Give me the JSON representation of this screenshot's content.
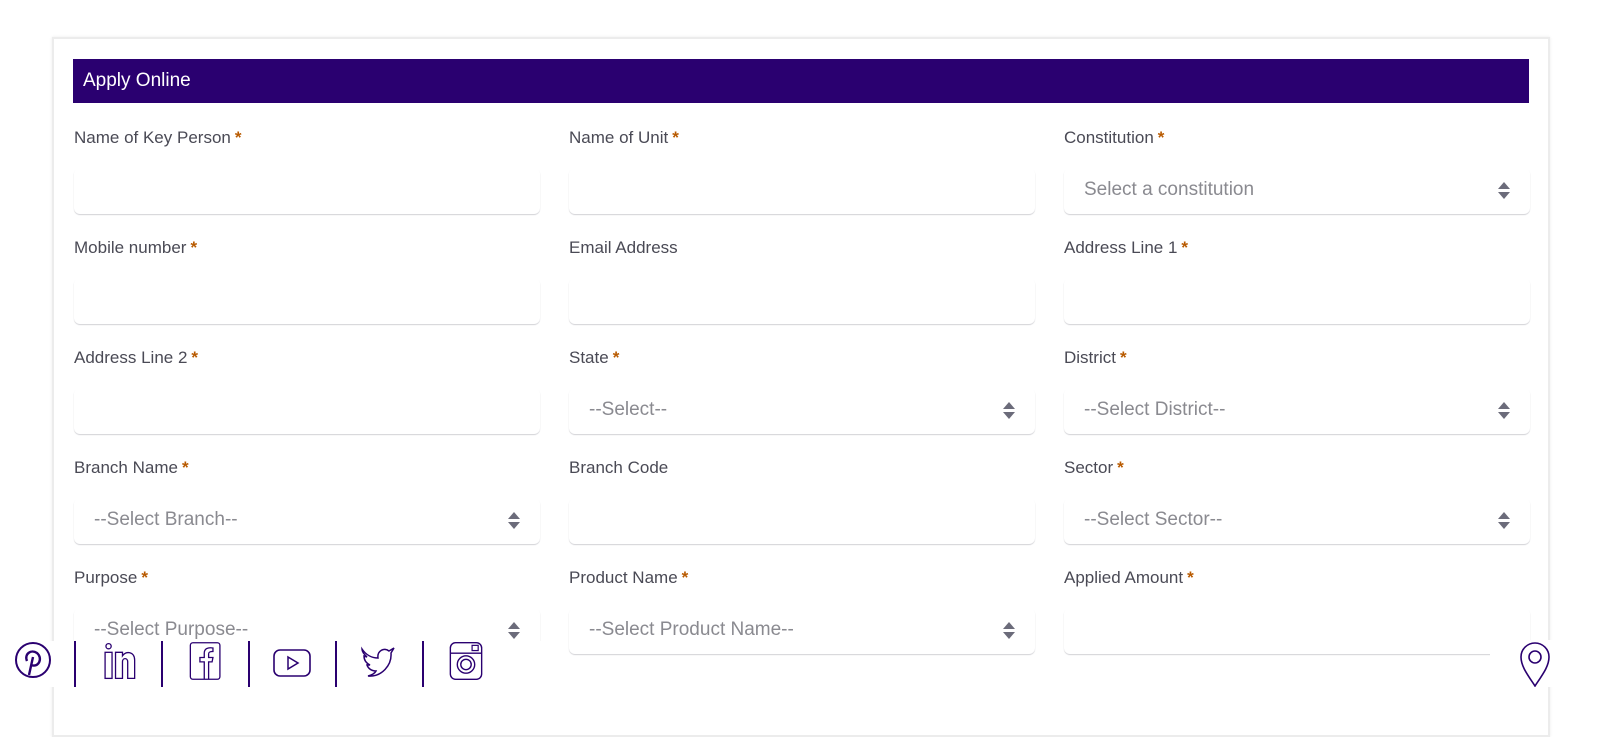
{
  "header": {
    "title": "Apply Online"
  },
  "colors": {
    "header_bg": "#2a0070",
    "required": "#b85a00",
    "icon": "#2a0070"
  },
  "fields": [
    {
      "label": "Name of Key Person",
      "required": true,
      "type": "input",
      "value": ""
    },
    {
      "label": "Name of Unit",
      "required": true,
      "type": "input",
      "value": ""
    },
    {
      "label": "Constitution",
      "required": true,
      "type": "select",
      "placeholder": "Select a constitution"
    },
    {
      "label": "Mobile number",
      "required": true,
      "type": "input",
      "value": ""
    },
    {
      "label": "Email Address",
      "required": false,
      "type": "input",
      "value": ""
    },
    {
      "label": "Address Line 1",
      "required": true,
      "type": "input",
      "value": ""
    },
    {
      "label": "Address Line 2",
      "required": true,
      "type": "input",
      "value": ""
    },
    {
      "label": "State",
      "required": true,
      "type": "select",
      "placeholder": "--Select--"
    },
    {
      "label": "District",
      "required": true,
      "type": "select",
      "placeholder": "--Select District--"
    },
    {
      "label": "Branch Name",
      "required": true,
      "type": "select",
      "placeholder": "--Select Branch--"
    },
    {
      "label": "Branch Code",
      "required": false,
      "type": "input",
      "value": ""
    },
    {
      "label": "Sector",
      "required": true,
      "type": "select",
      "placeholder": "--Select Sector--"
    },
    {
      "label": "Purpose",
      "required": true,
      "type": "select",
      "placeholder": "--Select Purpose--"
    },
    {
      "label": "Product Name",
      "required": true,
      "type": "select",
      "placeholder": "--Select Product Name--"
    },
    {
      "label": "Applied Amount",
      "required": true,
      "type": "input",
      "value": ""
    }
  ],
  "required_marker": "*",
  "social": [
    {
      "name": "pinterest-icon"
    },
    {
      "name": "linkedin-icon"
    },
    {
      "name": "facebook-icon"
    },
    {
      "name": "youtube-icon"
    },
    {
      "name": "twitter-icon"
    },
    {
      "name": "instagram-icon"
    }
  ],
  "location": {
    "icon": "location-pin-icon"
  }
}
